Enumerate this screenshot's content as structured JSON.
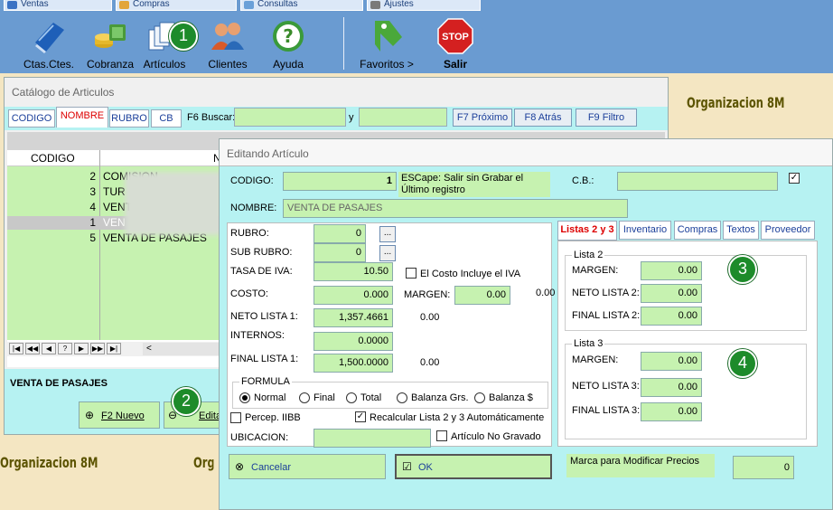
{
  "menu": {
    "items": [
      {
        "label": "Ventas"
      },
      {
        "label": "Compras"
      },
      {
        "label": "Consultas"
      },
      {
        "label": "Ajustes"
      }
    ]
  },
  "toolbar": {
    "ctas": "Ctas.Ctes.",
    "cobranza": "Cobranza",
    "articulos": "Artículos",
    "clientes": "Clientes",
    "ayuda": "Ayuda",
    "favoritos": "Favoritos >",
    "salir": "Salir",
    "stop": "STOP"
  },
  "brand": "Organizacion 8M",
  "badges": {
    "b1": "1",
    "b2": "2",
    "b3": "3",
    "b4": "4"
  },
  "catalog": {
    "title": "Catálogo de Articulos",
    "tabs": {
      "codigo": "CODIGO",
      "nombre": "NOMBRE",
      "rubro": "RUBRO",
      "cb": "CB"
    },
    "search_label": "F6 Buscar:",
    "search_and": "y",
    "btn_next": "F7 Próximo",
    "btn_prev": "F8 Atrás",
    "btn_filter": "F9 Filtro",
    "col_codigo": "CODIGO",
    "col_nombre": "N",
    "rows": [
      {
        "codigo": "2",
        "nombre": "COMISION"
      },
      {
        "codigo": "3",
        "nombre": "TUR"
      },
      {
        "codigo": "4",
        "nombre": "VENT"
      },
      {
        "codigo": "1",
        "nombre": "VEN"
      },
      {
        "codigo": "5",
        "nombre": "VENTA DE PASAJES"
      }
    ],
    "nav": [
      "|◀",
      "◀◀",
      "◀",
      "?",
      "▶",
      "▶▶",
      "▶|"
    ],
    "nav_left": "<",
    "selected_name": "VENTA DE PASAJES",
    "btn_new": "F2 Nuevo",
    "btn_edit": "Edita"
  },
  "edit": {
    "title": "Editando Artículo",
    "codigo_label": "CODIGO:",
    "codigo": "1",
    "escape_note": "ESCape: Salir sin Grabar el Último registro",
    "cb_label": "C.B.:",
    "cb": "",
    "cb_checked": "✓",
    "nombre_label": "NOMBRE:",
    "nombre": "VENTA DE PASAJES",
    "rubro_label": "RUBRO:",
    "rubro": "0",
    "subrubro_label": "SUB RUBRO:",
    "subrubro": "0",
    "dots": "...",
    "iva_label": "TASA DE  IVA:",
    "iva": "10.50",
    "costo_iva_label": "El Costo  Incluye el IVA",
    "costo_label": "COSTO:",
    "costo": "0.000",
    "margen_label": "MARGEN:",
    "margen": "0.00",
    "margen_extra": "0.00",
    "neto1_label": "NETO LISTA 1:",
    "neto1": "1,357.4661",
    "neto1_extra": "0.00",
    "internos_label": "INTERNOS:",
    "internos": "0.0000",
    "final1_label": "FINAL  LISTA 1:",
    "final1": "1,500.0000",
    "final1_extra": "0.00",
    "formula_label": "FORMULA",
    "formula_options": [
      "Normal",
      "Final",
      "Total",
      "Balanza Grs.",
      "Balanza $"
    ],
    "percep_label": "Percep. IIBB",
    "recalc_label": "Recalcular Lista 2 y 3 Automáticamente",
    "ubicacion_label": "UBICACION:",
    "ubicacion": "",
    "no_gravado_label": "Artículo No Gravado",
    "btn_cancel": "Cancelar",
    "btn_ok": "OK",
    "marca_label": "Marca para Modificar Precios",
    "marca": "0",
    "tabs": [
      "Listas 2 y 3",
      "Inventario",
      "Compras",
      "Textos",
      "Proveedor"
    ],
    "lista2": {
      "title": "Lista 2",
      "margen_label": "MARGEN:",
      "margen": "0.00",
      "neto_label": "NETO LISTA 2:",
      "neto": "0.00",
      "final_label": "FINAL LISTA 2:",
      "final": "0.00"
    },
    "lista3": {
      "title": "Lista 3",
      "margen_label": "MARGEN:",
      "margen": "0.00",
      "neto_label": "NETO LISTA 3:",
      "neto": "0.00",
      "final_label": "FINAL LISTA 3:",
      "final": "0.00"
    }
  }
}
